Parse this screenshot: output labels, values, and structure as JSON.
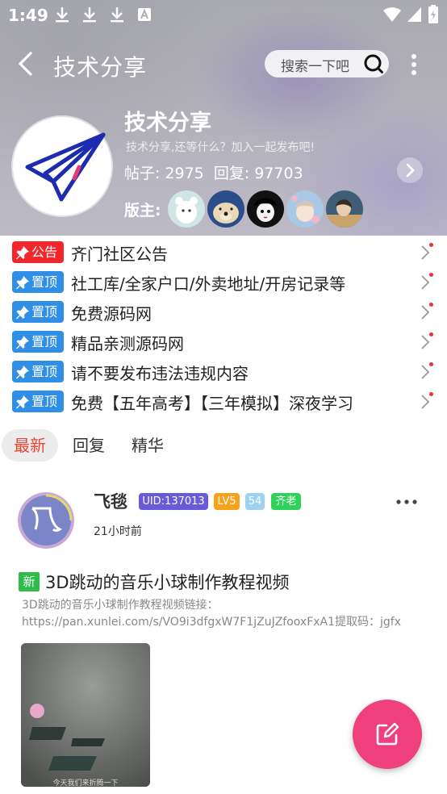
{
  "status_bar": {
    "time": "1:49"
  },
  "header": {
    "title": "技术分享",
    "search_placeholder": "搜索一下吧"
  },
  "forum": {
    "name": "技术分享",
    "description": "技术分享,还等什么？加入一起发布吧!",
    "posts_label": "帖子:",
    "posts": "2975",
    "replies_label": "回复:",
    "replies": "97703",
    "moderators_label": "版主:"
  },
  "notices": [
    {
      "badge": "公告",
      "badge_color": "#f2262b",
      "text": "齐门社区公告"
    },
    {
      "badge": "置顶",
      "badge_color": "#2f8fe6",
      "text": "社工库/全家户口/外卖地址/开房记录等"
    },
    {
      "badge": "置顶",
      "badge_color": "#2f8fe6",
      "text": "免费源码网"
    },
    {
      "badge": "置顶",
      "badge_color": "#2f8fe6",
      "text": "精品亲测源码网"
    },
    {
      "badge": "置顶",
      "badge_color": "#2f8fe6",
      "text": "请不要发布违法违规内容"
    },
    {
      "badge": "置顶",
      "badge_color": "#2f8fe6",
      "text": "免费【五年高考】【三年模拟】深夜学习"
    }
  ],
  "tabs": [
    {
      "label": "最新",
      "active": true
    },
    {
      "label": "回复",
      "active": false
    },
    {
      "label": "精华",
      "active": false
    }
  ],
  "post": {
    "author": "飞毯",
    "uid": "UID:137013",
    "level": "LV5",
    "number": "54",
    "tag": "齐老",
    "time": "21小时前",
    "new_badge": "新",
    "title": "3D跳动的音乐小球制作教程视频",
    "excerpt_line1": "3D跳动的音乐小球制作教程视频链接：",
    "excerpt_line2": "https://pan.xunlei.com/s/VO9i3dfgxW7F1jZuJZfooxFxA1提取码：jgfx",
    "image_caption": "今天我们来折腾一下"
  },
  "colors": {
    "accent_red": "#e8462f",
    "fab": "#ef3f7d",
    "uid_chip": "#6a5ad8",
    "level_chip": "#f7a21b",
    "tag_chip": "#2ed25a"
  }
}
